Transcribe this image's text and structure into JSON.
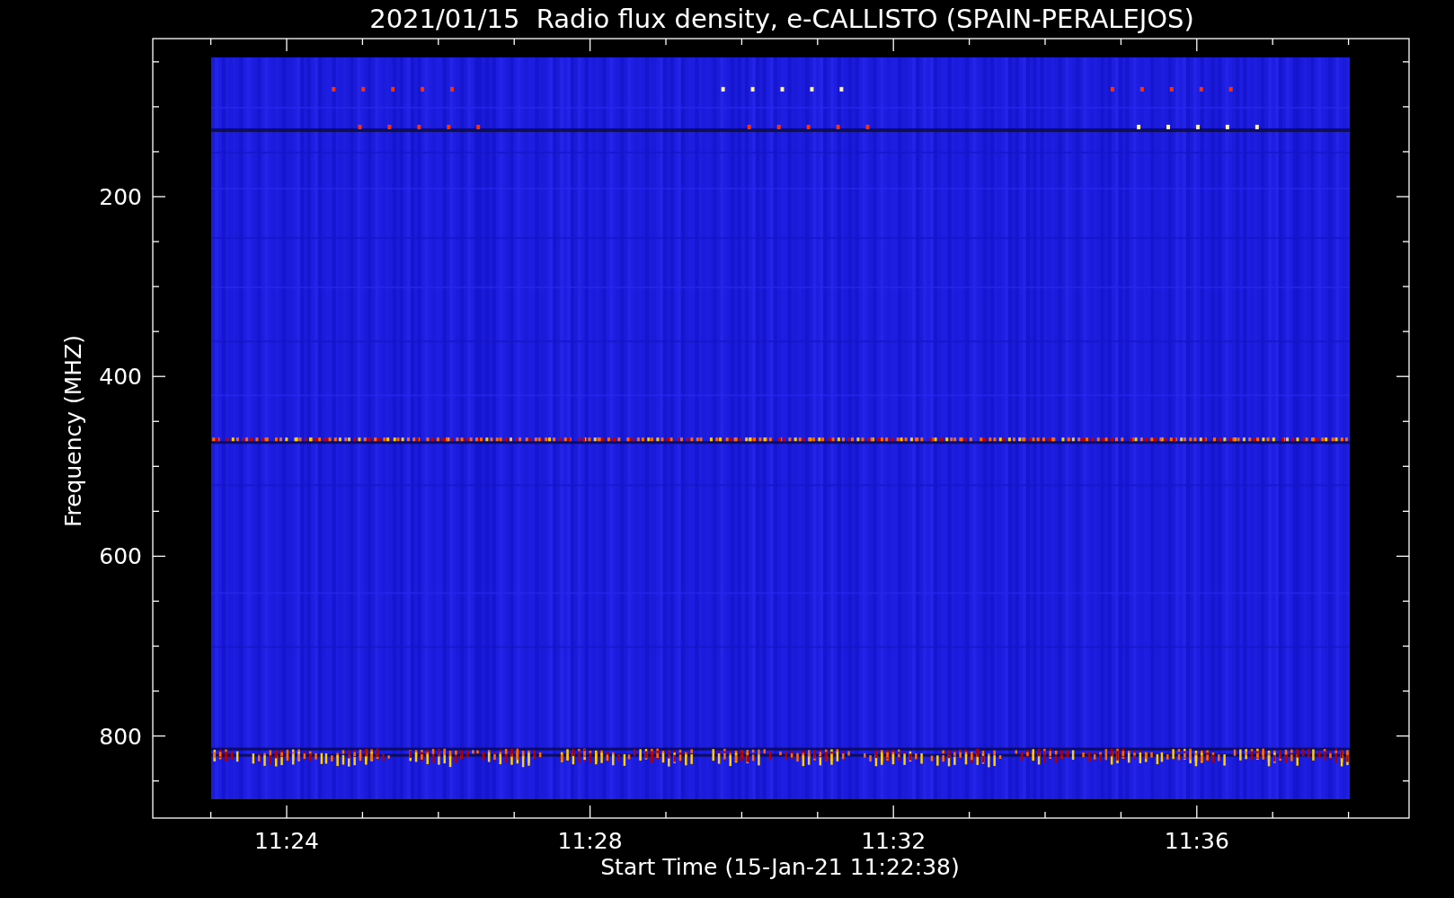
{
  "title": "2021/01/15  Radio flux density, e-CALLISTO (SPAIN-PERALEJOS)",
  "xlabel": "Start Time (15-Jan-21 11:22:38)",
  "ylabel": "Frequency (MHZ)",
  "xticks": [
    "11:24",
    "11:28",
    "11:32",
    "11:36"
  ],
  "yticks": [
    "200",
    "400",
    "600",
    "800"
  ]
}
